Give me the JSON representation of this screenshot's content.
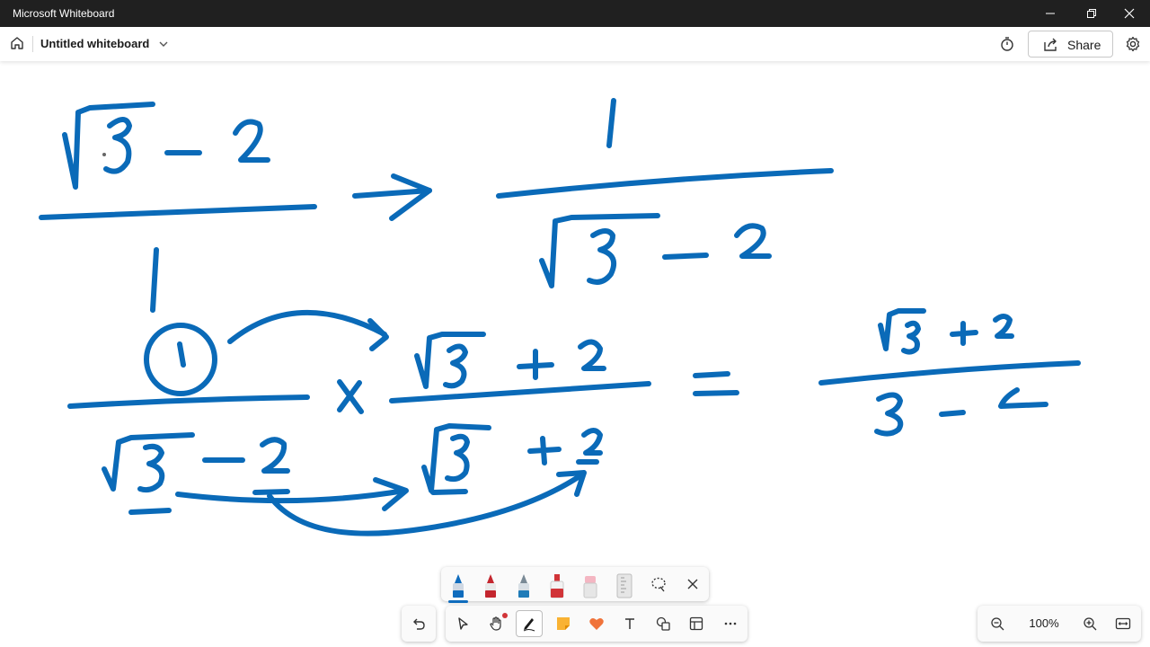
{
  "window": {
    "title": "Microsoft Whiteboard"
  },
  "appbar": {
    "board_title": "Untitled whiteboard",
    "share_label": "Share"
  },
  "icons": {
    "home": "home-icon",
    "chevron": "chevron-down-icon",
    "timer": "timer-icon",
    "share": "share-icon",
    "settings": "gear-icon",
    "undo": "undo-icon",
    "select": "select-arrow-icon",
    "hand": "hand-icon",
    "pen": "pen-icon",
    "note": "sticky-note-icon",
    "reaction": "heart-icon",
    "text": "text-icon",
    "shapes": "shapes-icon",
    "template": "template-icon",
    "more": "more-icon",
    "zoom_out": "zoom-out-icon",
    "zoom_in": "zoom-in-icon",
    "fit": "fit-to-screen-icon",
    "lasso": "lasso-select-icon",
    "close": "close-icon"
  },
  "zoom": {
    "level": "100%"
  },
  "colors": {
    "ink": "#0a6ab8",
    "accent": "#0f6cbd",
    "titlebar": "#202020"
  },
  "pen_tray": {
    "pens": [
      "blue pen",
      "red pen",
      "gray pen",
      "red highlighter",
      "eraser",
      "ruler"
    ],
    "selected": "blue pen"
  }
}
